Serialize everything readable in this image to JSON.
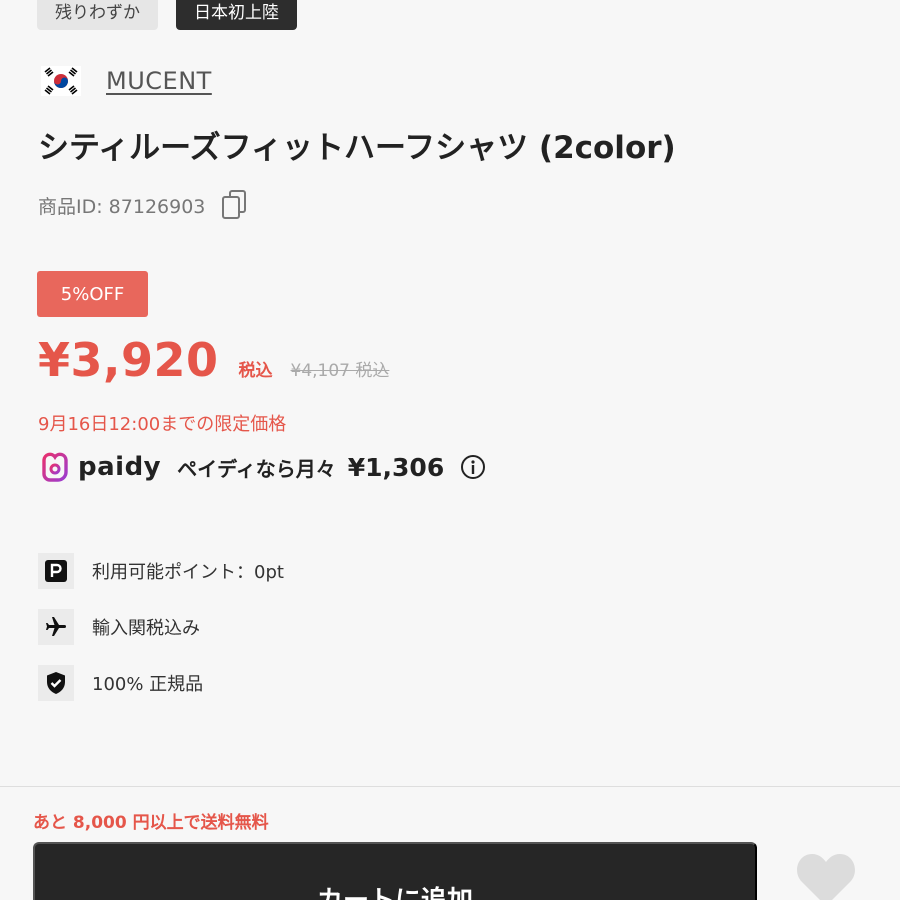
{
  "tags": [
    "残りわずか",
    "日本初上陸"
  ],
  "brand": {
    "name": "MUCENT",
    "flag_icon": "korea-flag-icon"
  },
  "product": {
    "title": "シティルーズフィットハーフシャツ (2color)",
    "id_label": "商品ID: 87126903"
  },
  "pricing": {
    "discount_badge": "5%OFF",
    "price": "¥3,920",
    "tax_label": "税込",
    "original_price": "¥4,107 税込",
    "limited_text": "9月16日12:00までの限定価格",
    "accent_color": "#e5564a"
  },
  "paidy": {
    "logo_text": "paidy",
    "text": "ペイディなら月々",
    "amount": "¥1,306"
  },
  "features": [
    {
      "icon": "points-icon",
      "label": "利用可能ポイント：0pt"
    },
    {
      "icon": "airplane-icon",
      "label": "輸入関税込み"
    },
    {
      "icon": "shield-check-icon",
      "label": "100% 正規品"
    }
  ],
  "shipping_note": "あと 8,000 円以上で送料無料",
  "cart_button_label": "カートに追加"
}
